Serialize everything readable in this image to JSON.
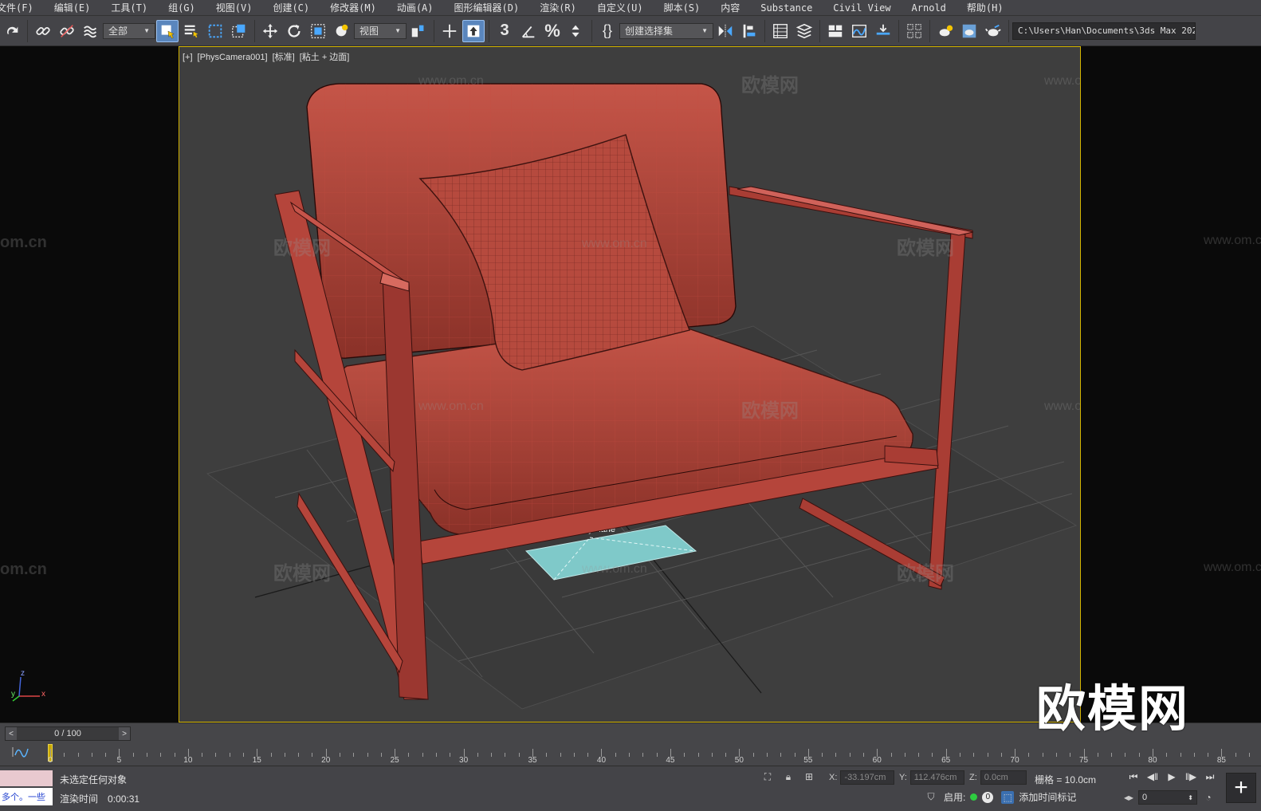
{
  "menu": {
    "items": [
      "文件(F)",
      "编辑(E)",
      "工具(T)",
      "组(G)",
      "视图(V)",
      "创建(C)",
      "修改器(M)",
      "动画(A)",
      "图形编辑器(D)",
      "渲染(R)",
      "自定义(U)",
      "脚本(S)",
      "内容",
      "Substance",
      "Civil View",
      "Arnold",
      "帮助(H)"
    ]
  },
  "toolbar": {
    "selection_filter": "全部",
    "reference_coord": "视图",
    "named_selection": "创建选择集",
    "snap_label": "3",
    "project_path": "C:\\Users\\Han\\Documents\\3ds Max 2022"
  },
  "viewport": {
    "label_plus": "[+]",
    "label_camera": "[PhysCamera001]",
    "label_shading_mode": "[标准]",
    "label_display": "[粘土 + 边面]",
    "object_label": "VRayPlane",
    "watermark_cn": "欧模网",
    "watermark_url": "www.om.cn",
    "watermark_url_partial": "om.cn",
    "logo": "欧模网",
    "axis_x": "x",
    "axis_y": "y",
    "axis_z": "z"
  },
  "colors": {
    "chair": "#b6463c",
    "chair_dark": "#7c2a24",
    "plane": "#7fc9c9",
    "viewport_border": "#d4b400",
    "active_tool": "#5a86bd"
  },
  "timeline": {
    "frame_display": "0 / 100",
    "ruler_labels": [
      "0",
      "5",
      "10",
      "15",
      "20",
      "25",
      "30",
      "35",
      "40",
      "45",
      "50",
      "55",
      "60",
      "65",
      "70",
      "75",
      "80",
      "85"
    ]
  },
  "status": {
    "selection_status": "未选定任何对象",
    "render_time_label": "渲染时间",
    "render_time_value": "0:00:31",
    "maxscript_text": "多个。一些",
    "x_label": "X:",
    "x_value": "-33.197cm",
    "y_label": "Y:",
    "y_value": "112.476cm",
    "z_label": "Z:",
    "z_value": "0.0cm",
    "grid": "栅格 = 10.0cm",
    "enable_label": "启用:",
    "enable_count": "0",
    "add_time_tag": "添加时间标记",
    "current_frame": "0"
  }
}
